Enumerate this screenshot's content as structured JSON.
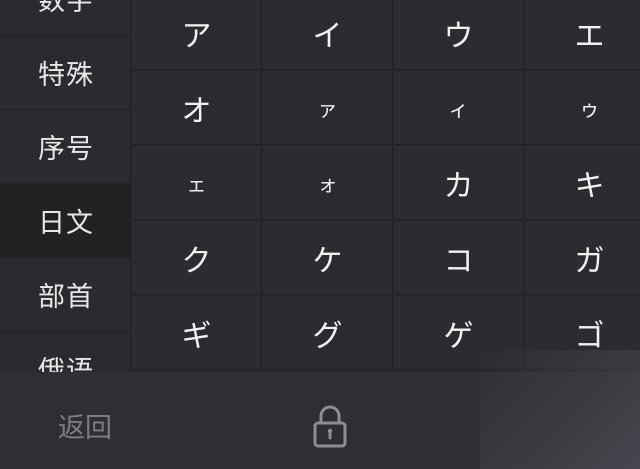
{
  "categories": [
    {
      "label": "数字",
      "selected": false
    },
    {
      "label": "特殊",
      "selected": false
    },
    {
      "label": "序号",
      "selected": false
    },
    {
      "label": "日文",
      "selected": true
    },
    {
      "label": "部首",
      "selected": false
    },
    {
      "label": "俄语",
      "selected": false
    }
  ],
  "grid": {
    "rows": [
      [
        "ア",
        "イ",
        "ウ",
        "エ"
      ],
      [
        "オ",
        "ァ",
        "ィ",
        "ゥ"
      ],
      [
        "ェ",
        "ォ",
        "カ",
        "キ"
      ],
      [
        "ク",
        "ケ",
        "コ",
        "ガ"
      ],
      [
        "ギ",
        "グ",
        "ゲ",
        "ゴ"
      ]
    ]
  },
  "bottom_bar": {
    "back_label": "返回",
    "lock_icon": "lock-icon"
  },
  "colors": {
    "background": "#29292d",
    "selected_category": "#222225",
    "text": "#f2f2f4",
    "muted_text": "#7d7d82"
  }
}
